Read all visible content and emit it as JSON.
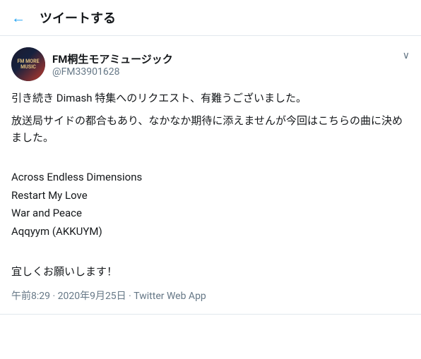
{
  "header": {
    "back_icon": "←",
    "title": "ツイートする"
  },
  "tweet": {
    "author": {
      "name": "FM桐生モアミュージック",
      "handle": "@FM33901628",
      "avatar_text": "FM MORE\nMUSIC"
    },
    "chevron": "∨",
    "body_lines": [
      "引き続き Dimash 特集へのリクエスト、有難うございました。",
      "放送局サイドの都合もあり、なかなか期待に添えませんが今回はこちらの曲に決めました。"
    ],
    "songs": [
      "Across Endless Dimensions",
      "Restart My Love",
      "War and Peace",
      "Aqqyym (AKKUYM)"
    ],
    "closing": "宜しくお願いします！",
    "meta": "午前8:29 · 2020年9月25日 · Twitter Web App"
  }
}
